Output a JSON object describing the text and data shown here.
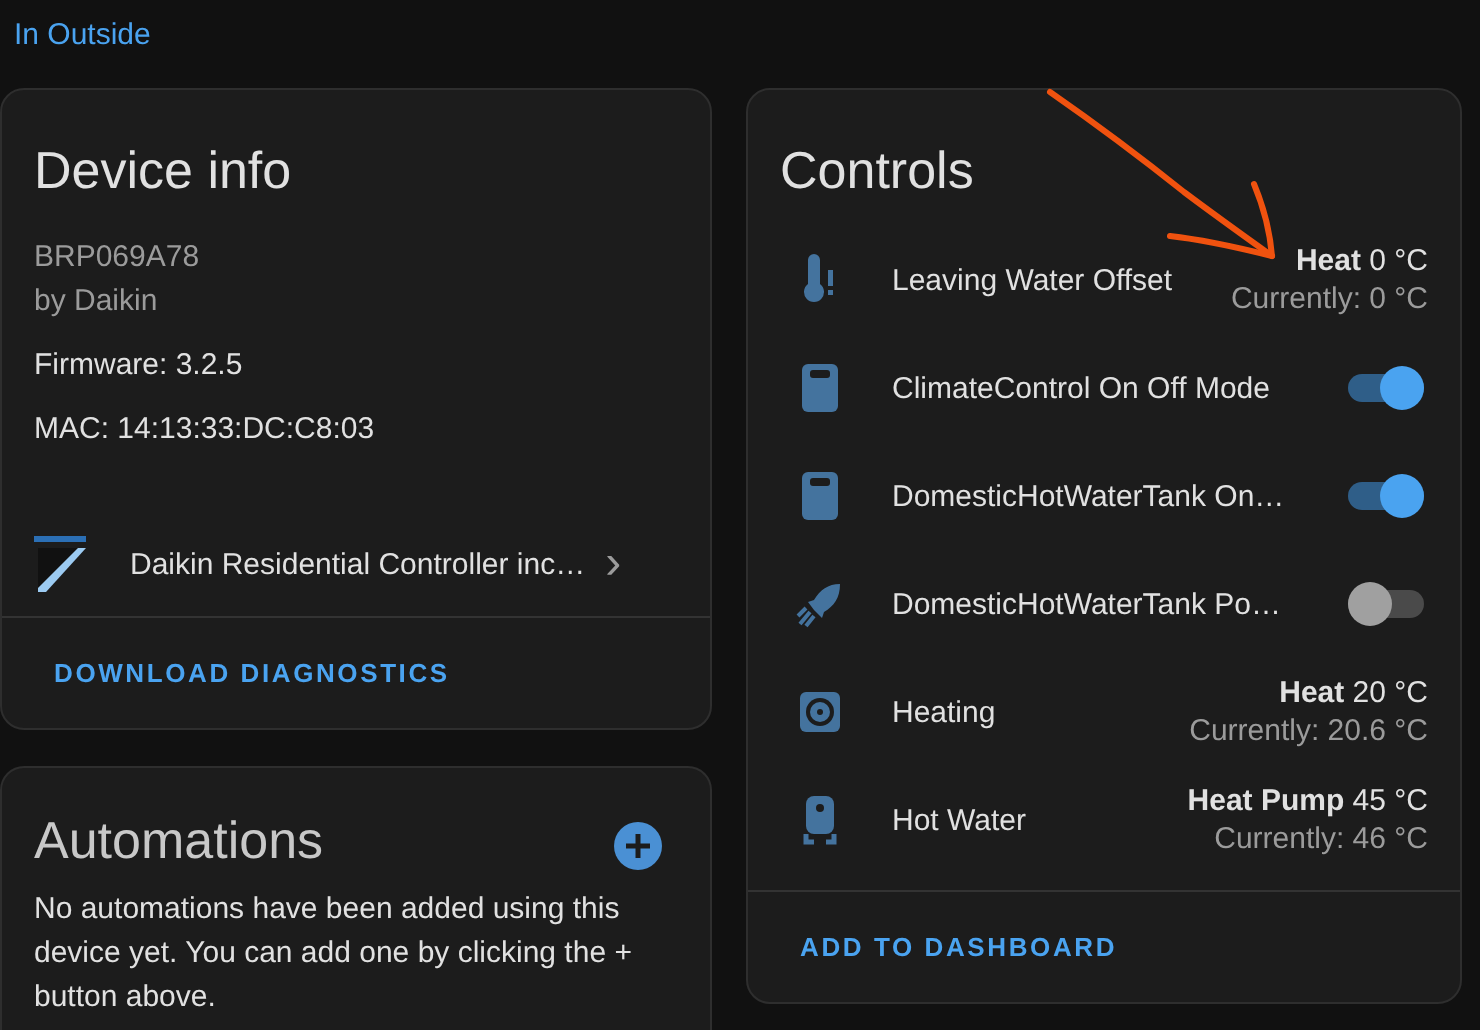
{
  "breadcrumb": {
    "link": "In Outside"
  },
  "device_info": {
    "title": "Device info",
    "model": "BRP069A78",
    "manufacturer": "by Daikin",
    "firmware": "Firmware: 3.2.5",
    "mac": "MAC: 14:13:33:DC:C8:03",
    "integration": {
      "label": "Daikin Residential Controller inc…",
      "chevron": "›"
    },
    "action": "DOWNLOAD DIAGNOSTICS"
  },
  "controls": {
    "title": "Controls",
    "rows": [
      {
        "kind": "climate",
        "name": "Leaving Water Offset",
        "target": "**Heat** 0 °C",
        "current": "Currently: 0 °C"
      },
      {
        "kind": "switch",
        "name": "ClimateControl On Off Mode",
        "on": true
      },
      {
        "kind": "switch",
        "name": "DomesticHotWaterTank On…",
        "on": true
      },
      {
        "kind": "switch",
        "name": "DomesticHotWaterTank Po…",
        "on": false
      },
      {
        "kind": "climate",
        "name": "Heating",
        "target": "**Heat** 20 °C",
        "current": "Currently: 20.6 °C"
      },
      {
        "kind": "climate",
        "name": "Hot Water",
        "target": "**Heat Pump** 45 °C",
        "current": "Currently: 46 °C"
      }
    ],
    "action": "ADD TO DASHBOARD"
  },
  "automations": {
    "title": "Automations",
    "message": "No automations have been added using this device yet. You can add one by clicking the + button above."
  }
}
